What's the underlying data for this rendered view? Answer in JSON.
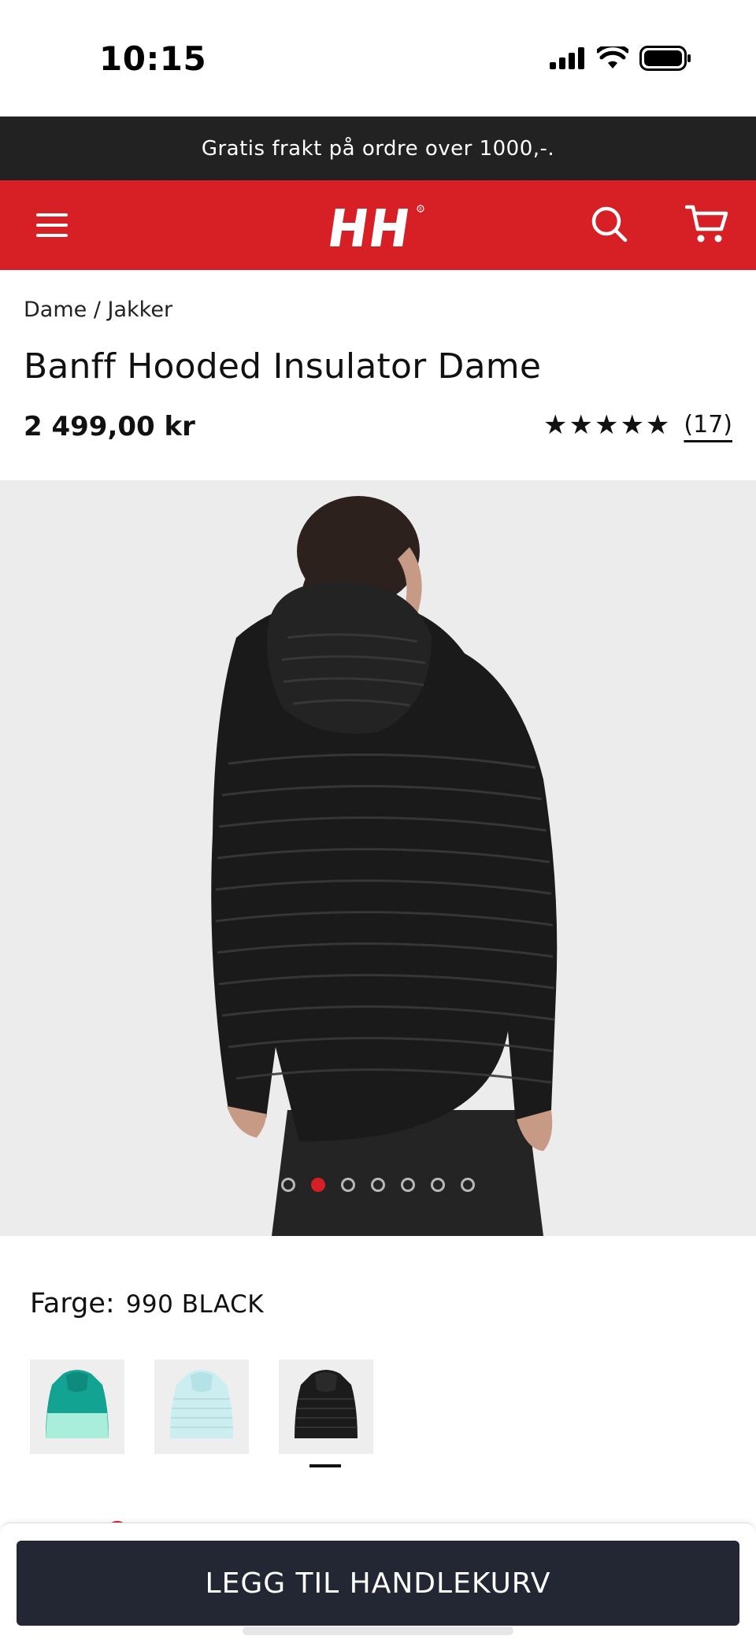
{
  "status_bar": {
    "time": "10:15"
  },
  "promo": {
    "text": "Gratis frakt på ordre over 1000,-."
  },
  "header": {
    "logo_text": "HH",
    "brand_color": "#d71f26"
  },
  "breadcrumb": {
    "items": [
      "Dame",
      "Jakker"
    ],
    "separator": " / "
  },
  "product": {
    "title": "Banff Hooded Insulator Dame",
    "price": "2 499,00 kr",
    "rating": {
      "stars": 5,
      "review_count": "(17)"
    }
  },
  "gallery": {
    "image_count": 7,
    "active_index": 1
  },
  "color": {
    "label": "Farge:",
    "selected_value": "990 BLACK",
    "swatches": [
      {
        "name": "teal",
        "color": "#13a393"
      },
      {
        "name": "light-blue",
        "color": "#cdeef0"
      },
      {
        "name": "black",
        "color": "#1b1b1b"
      }
    ],
    "selected_index": 2
  },
  "cta": {
    "label": "LEGG TIL HANDLEKURV"
  }
}
